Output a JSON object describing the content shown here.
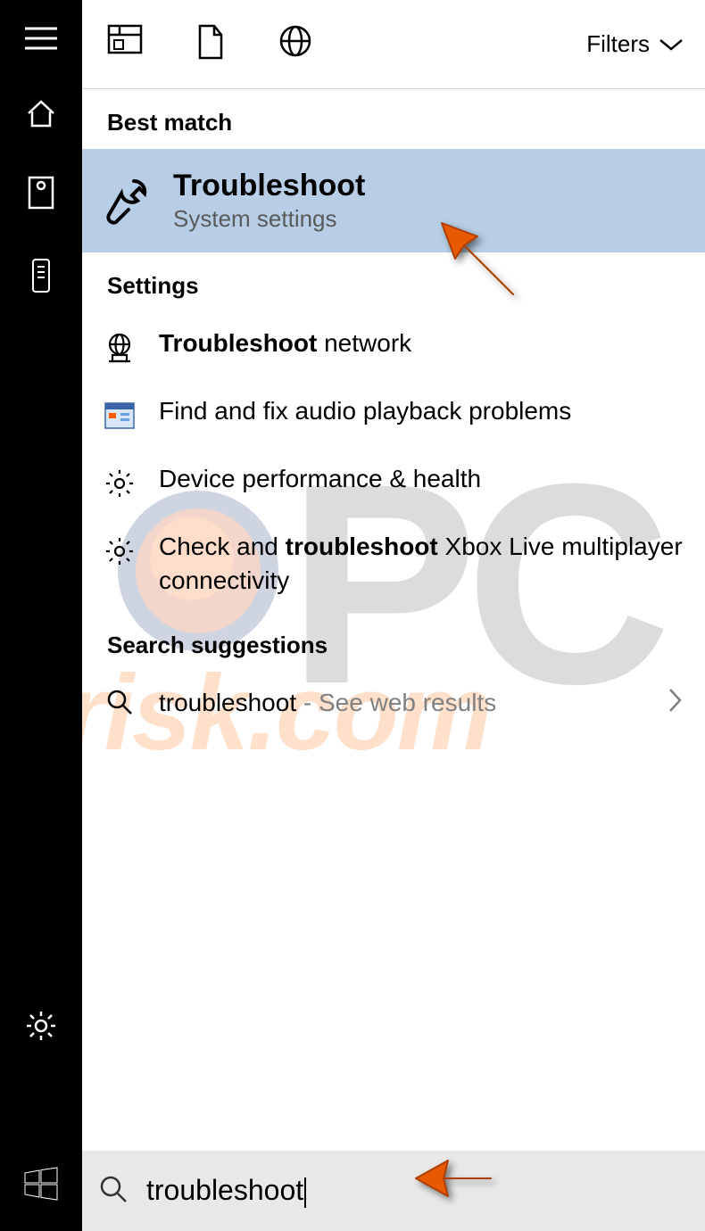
{
  "topbar": {
    "filters_label": "Filters"
  },
  "sections": {
    "best_match": "Best match",
    "settings": "Settings",
    "suggestions": "Search suggestions"
  },
  "best_match": {
    "title": "Troubleshoot",
    "subtitle": "System settings"
  },
  "settings_results": {
    "r0_bold": "Troubleshoot",
    "r0_rest": " network",
    "r1": "Find and fix audio playback problems",
    "r2": "Device performance & health",
    "r3_pre": "Check and ",
    "r3_bold": "troubleshoot",
    "r3_post": " Xbox Live multiplayer connectivity"
  },
  "suggestion": {
    "term": "troubleshoot",
    "hint": " - See web results"
  },
  "search": {
    "value": "troubleshoot"
  }
}
